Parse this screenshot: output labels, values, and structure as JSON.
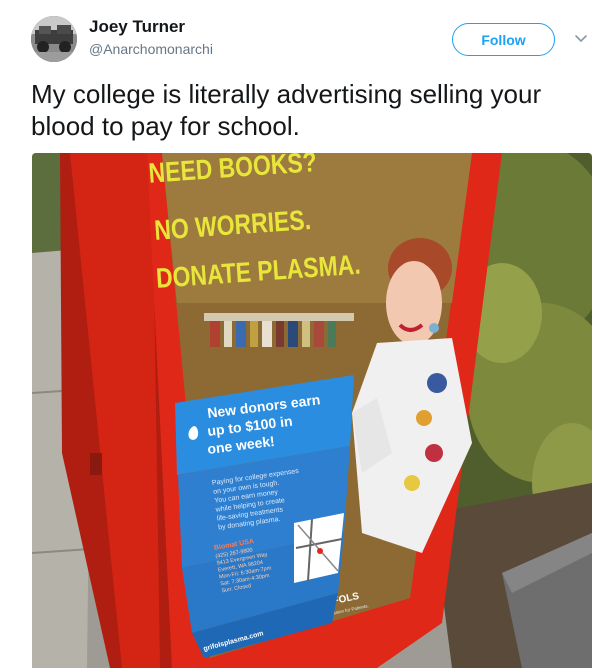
{
  "author": {
    "name": "Joey Turner",
    "handle": "@Anarchomonarchi"
  },
  "actions": {
    "follow_label": "Follow",
    "menu_icon": "chevron-down-icon"
  },
  "tweet": {
    "text": "My college is literally advertising selling your blood to pay for school."
  },
  "photo": {
    "ad_heading_line1": "NEED BOOKS?",
    "ad_heading_line2": "NO WORRIES.",
    "ad_heading_line3": "DONATE PLASMA.",
    "callout_line1": "New donors earn",
    "callout_line2": "up to $100 in",
    "callout_line3": "one week!",
    "body_lines": [
      "Paying for college expenses",
      "on your own is tough.",
      "You can earn money",
      "while helping to create",
      "life-saving treatments",
      "by donating plasma."
    ],
    "center_name": "Biomat USA",
    "center_phone": "(425) 267-9800",
    "center_address": "9413 Evergreen Way",
    "center_city": "Everett, WA 98204",
    "hours_1": "Mon-Fri: 6:30am-7pm",
    "hours_2": "Sat: 7:30am-4:30pm",
    "hours_3": "Sun: Closed",
    "brand": "GRIFOLS",
    "brand_tagline": "Pride for Donors. Passion for Patients.",
    "website": "grifolsplasma.com",
    "colors": {
      "kiosk_red": "#e02818",
      "heading_yellow": "#e8e63a",
      "callout_blue": "#2a8de0"
    }
  },
  "colors": {
    "link_blue": "#1da1f2",
    "text_primary": "#14171a",
    "text_secondary": "#657786"
  }
}
